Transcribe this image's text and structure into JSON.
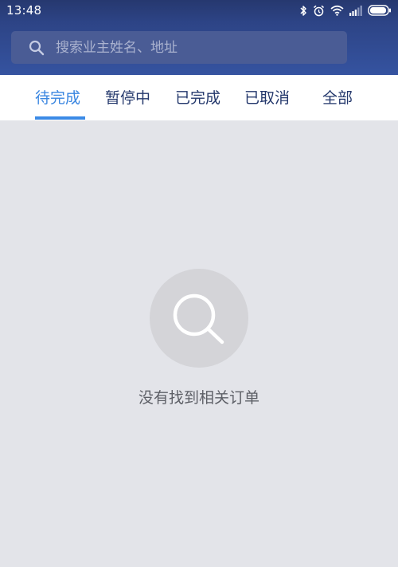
{
  "status_bar": {
    "time": "13:48",
    "icons": [
      "bluetooth-icon",
      "alarm-icon",
      "wifi-icon",
      "signal-icon",
      "battery-icon"
    ]
  },
  "search": {
    "placeholder": "搜索业主姓名、地址",
    "value": ""
  },
  "tabs": [
    {
      "label": "待完成",
      "active": true
    },
    {
      "label": "暂停中",
      "active": false
    },
    {
      "label": "已完成",
      "active": false
    },
    {
      "label": "已取消",
      "active": false
    },
    {
      "label": "全部",
      "active": false
    }
  ],
  "empty_state": {
    "icon": "search-icon",
    "message": "没有找到相关订单"
  },
  "colors": {
    "header": "#2d4486",
    "active_tab": "#3a86e0",
    "tab_text": "#24386c",
    "background": "#e3e4e9"
  }
}
